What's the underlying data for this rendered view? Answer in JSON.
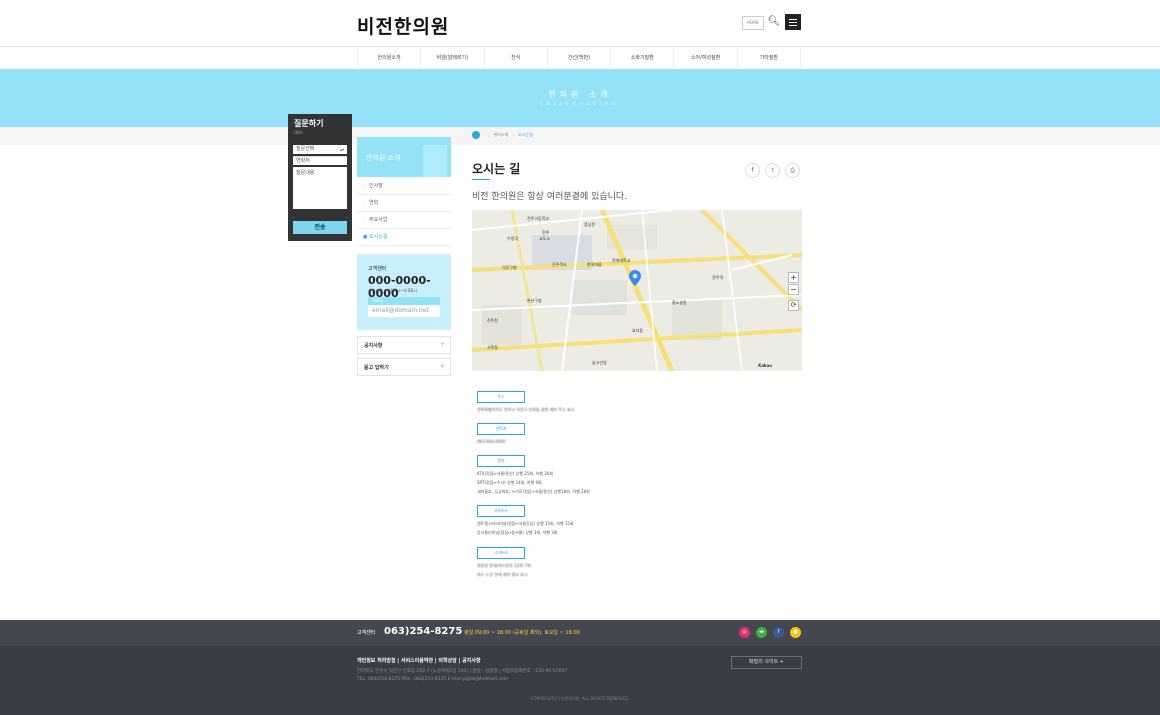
{
  "header": {
    "logo": "비전한의원",
    "home_label": "HOME",
    "search_icon": "search-icon",
    "menu_icon": "hamburger-icon"
  },
  "gnb": [
    "한의원소개",
    "비염(알레르기)",
    "천식",
    "간선(백반)",
    "소화기질환",
    "소아/여성질환",
    "기타질환"
  ],
  "banner": {
    "title": "한의원 소개",
    "subtitle": "Introduction"
  },
  "qna": {
    "title": "질문하기",
    "subtitle": "QNA",
    "select_value": "질문선택",
    "contact_placeholder": "연락처",
    "content_placeholder": "질문내용",
    "send_label": "전송"
  },
  "side": {
    "title": "한의원 소개",
    "menu": [
      {
        "label": "인사말",
        "active": false
      },
      {
        "label": "연혁",
        "active": false
      },
      {
        "label": "주요사업",
        "active": false
      },
      {
        "label": "오시는길",
        "active": true
      }
    ],
    "cs": {
      "label": "고객센터",
      "phone": "000-0000-0000",
      "hours": "상담시간 : 오전9시~오후6시",
      "mail_label": "이메일",
      "mail_value": "email@domain.net"
    },
    "links": [
      {
        "label": "공지사항",
        "plus": "+"
      },
      {
        "label": "묻고 답하기",
        "plus": "+"
      }
    ]
  },
  "breadcrumb": {
    "parent": "센터소개",
    "current": "오시는길"
  },
  "main": {
    "title": "오시는 길",
    "intro": "비전 한의원은 항상 여러분곁에 있습니다."
  },
  "share": {
    "facebook": "f",
    "twitter": "t",
    "print": "⎙"
  },
  "map": {
    "labels": [
      "전주고등학교",
      "전주",
      "교도소",
      "우정국",
      "풍남문",
      "덕진구청",
      "전주객사",
      "한옥마을",
      "전북대학교",
      "완산구청",
      "전주천",
      "서학동",
      "중노송동",
      "전주역",
      "효자동",
      "남고산성"
    ],
    "zoom_in": "+",
    "zoom_out": "−",
    "reset": "⟳",
    "attribution": "Kakao"
  },
  "info": {
    "address_cap": "주소",
    "address_line": "전북특별자치도 전주시 덕진구 인후동 관련 세부 주소 표시",
    "contact_cap": "연락처",
    "contact_line": "063-000-0000",
    "train_cap": "열차",
    "train_lines": [
      "KTX(정읍↔서울/용산) 상행 25회, 하행 26회",
      "SRT(정읍↔수서) 상행 14회, 하행 9회",
      "새마을호, 무궁화호, 누리로(정읍↔서울/용산) 상행18회, 하행 26회"
    ],
    "express_cap": "고속버스",
    "express_lines": [
      "센트럴시티터미널(정읍↔서울강남) 상행 15회, 하행 15회",
      "동서울터미널(정읍↔동서울) 상행 3회, 하행 3회"
    ],
    "city_cap": "시내버스",
    "city_lines": [
      "정류장 안내(버스번호 124) 7회",
      "버스 노선 안내 세부 정보 표시"
    ]
  },
  "footer": {
    "cs_label": "고객센터",
    "phone": "063)254-8275",
    "hours": "평일 09:00 ~ 18:00 (공휴일 제외), 토요일 ~ 16:00",
    "links": "개인정보 처리방침 | 서비스이용약관 | 의학상담 | 공지사항",
    "address": "전라북도 전주시 덕진구 인후동 292-7 (노송여울2길 140) | 원장 : 김광열 | 사업자등록번호 : 120-90-67607",
    "tel": "TEL: 063)254-8275 FAX : 063)254-8535 E-mail:pghw@hotmail.com",
    "copyright": "COPYRIGHT(C) 비전한의원. ALL RIGHTS RESERVED.",
    "family_label": "패밀리 사이트 +",
    "sns": [
      {
        "name": "instagram-icon",
        "glyph": "◎",
        "color": "#e1306c"
      },
      {
        "name": "kakaotalk-icon",
        "glyph": "▬",
        "color": "#3cb14a"
      },
      {
        "name": "facebook-icon",
        "glyph": "f",
        "color": "#3b5998"
      },
      {
        "name": "kakaostory-icon",
        "glyph": "●",
        "color": "#f5c518"
      }
    ]
  }
}
